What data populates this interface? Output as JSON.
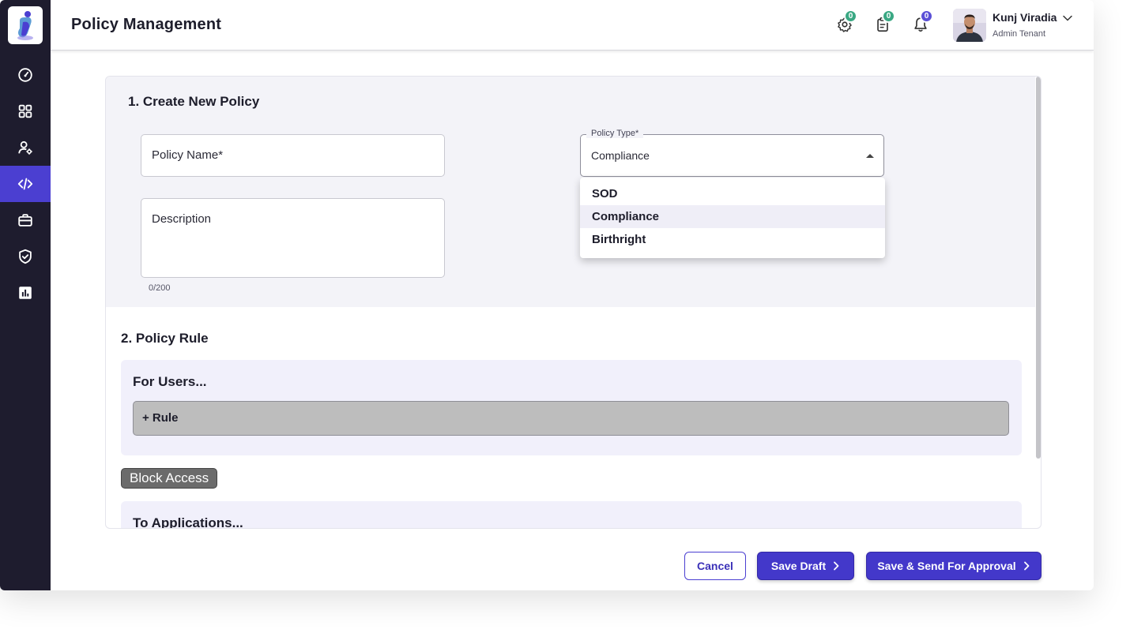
{
  "header": {
    "title": "Policy Management",
    "settings_badge": "0",
    "tasks_badge": "0",
    "notifications_badge": "0",
    "user_name": "Kunj Viradia",
    "user_role": "Admin Tenant"
  },
  "sidebar": {
    "items": [
      {
        "icon": "dashboard-gauge-icon",
        "active": false
      },
      {
        "icon": "grid-apps-icon",
        "active": false
      },
      {
        "icon": "user-settings-icon",
        "active": false
      },
      {
        "icon": "code-policy-icon",
        "active": true
      },
      {
        "icon": "briefcase-icon",
        "active": false
      },
      {
        "icon": "shield-check-icon",
        "active": false
      },
      {
        "icon": "bar-chart-icon",
        "active": false
      }
    ]
  },
  "section1": {
    "title": "1. Create New Policy",
    "policy_name_placeholder": "Policy Name*",
    "description_placeholder": "Description",
    "description_counter": "0/200",
    "policy_type_label": "Policy Type*",
    "policy_type_value": "Compliance",
    "policy_type_options": [
      "SOD",
      "Compliance",
      "Birthright"
    ]
  },
  "section2": {
    "title": "2. Policy Rule",
    "for_users_label": "For Users...",
    "add_rule_label": "+ Rule",
    "block_access_label": "Block Access",
    "to_applications_label": "To Applications..."
  },
  "footer": {
    "cancel_label": "Cancel",
    "save_draft_label": "Save Draft",
    "save_send_label": "Save & Send For Approval"
  },
  "colors": {
    "sidebar_bg": "#1e1c2e",
    "accent": "#4338ca",
    "badge_green": "#3aa883",
    "badge_purple": "#5b50d6"
  }
}
